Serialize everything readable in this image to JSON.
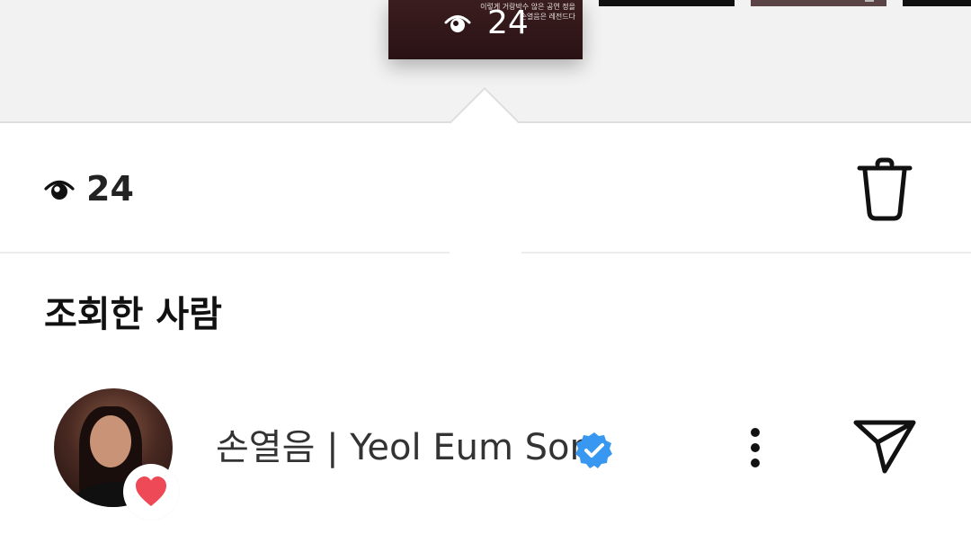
{
  "story_strip": {
    "active_thumb_caption": "이렇게 거랑박수 않은 공연 정을 손열음은 레전드다",
    "active_thumb_count": "24"
  },
  "views": {
    "count": "24",
    "eye_icon": "eye-icon",
    "delete_icon": "trash-icon"
  },
  "section": {
    "title": "조회한 사람"
  },
  "viewers": [
    {
      "name": "손열음 | Yeol Eum Son",
      "verified": true,
      "reaction": "heart",
      "reaction_color": "#ed4956",
      "verified_color": "#3897f0"
    }
  ]
}
